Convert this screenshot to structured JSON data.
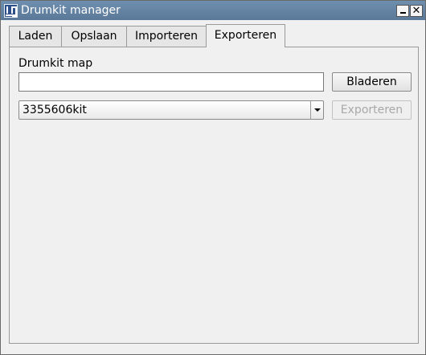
{
  "window": {
    "title": "Drumkit manager",
    "minimize_icon": "minimize-icon",
    "close_symbol": "✕"
  },
  "tabs": [
    {
      "label": "Laden",
      "selected": false
    },
    {
      "label": "Opslaan",
      "selected": false
    },
    {
      "label": "Importeren",
      "selected": false
    },
    {
      "label": "Exporteren",
      "selected": true
    }
  ],
  "export_tab": {
    "folder_label": "Drumkit map",
    "folder_value": "",
    "browse_label": "Bladeren",
    "kit_select_value": "3355606kit",
    "export_label": "Exporteren",
    "export_enabled": false
  },
  "colors": {
    "titlebar": "#5a7898",
    "window_bg": "#f0f0f0",
    "disabled_text": "#a8a8a8"
  }
}
